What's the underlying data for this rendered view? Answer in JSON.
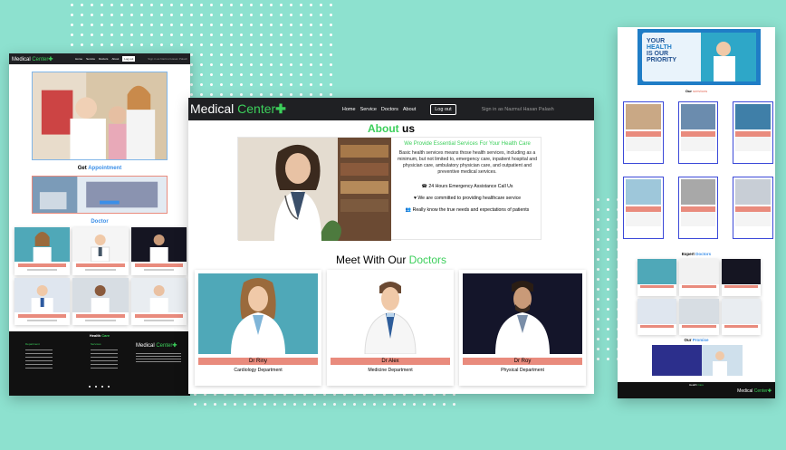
{
  "brand": {
    "name": "Medical ",
    "accent": "Center",
    "plus": "✚"
  },
  "nav": {
    "links": [
      "Home",
      "Service",
      "Doctors",
      "About"
    ],
    "logout": "Log out",
    "signed_in": "Sign in as Nazmul Hasan Palash"
  },
  "about": {
    "title_a": "About",
    "title_b": " us",
    "subtitle": "We Provide Essential Services For Your Health Care",
    "body": "Basic health services means those health services, including as a minimum, but not limited to, emergency care, inpatient hospital and physician care, ambulatory physician care, and outpatient and preventive medical services.",
    "points": [
      "24 Hours Emergency Assistance Call Us",
      "We are committed to providing healthcare service",
      "Really know the true needs and expectations of patients"
    ]
  },
  "doctors": {
    "title_a": "Meet With Our ",
    "title_b": "Doctors",
    "items": [
      {
        "name": "Dr Riny",
        "dept": "Cardiology Department"
      },
      {
        "name": "Dr Alex",
        "dept": "Medicine Department"
      },
      {
        "name": "Dr Roy",
        "dept": "Physical Department"
      }
    ]
  },
  "left": {
    "appointment_a": "Get ",
    "appointment_b": "Appointment",
    "doctor_heading": "Doctor",
    "footer_title_a": "Health ",
    "footer_title_b": "Care",
    "col1": "Department",
    "col2": "Services"
  },
  "right": {
    "hero_line1": "YOUR",
    "hero_line2": "HEALTH",
    "hero_line3": "IS OUR",
    "hero_line4": "PRIORITY",
    "services_a": "Our ",
    "services_b": "services",
    "expert_a": "Expert ",
    "expert_b": "Doctors",
    "promise_a": "Our ",
    "promise_b": "Promise",
    "footer_a": "Health ",
    "footer_b": "Care"
  },
  "colors": {
    "accent_green": "#3ccf5b",
    "accent_blue": "#3b8fe8",
    "salmon": "#e98b7d",
    "nav_dark": "#1f2023",
    "background": "#8de1cf"
  }
}
